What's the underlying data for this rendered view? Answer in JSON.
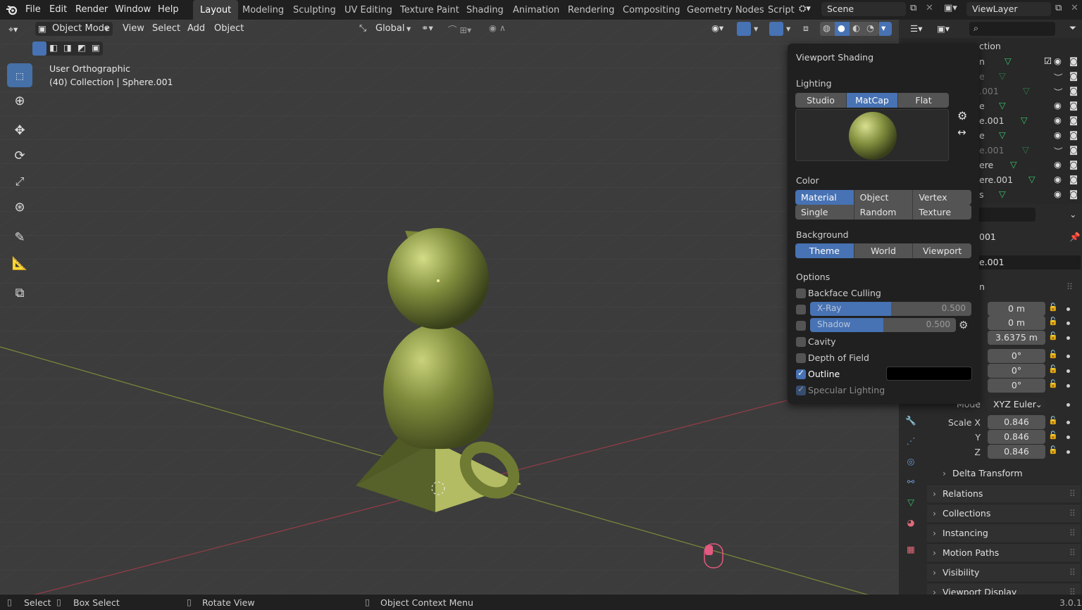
{
  "topbar": {
    "menus": [
      "File",
      "Edit",
      "Render",
      "Window",
      "Help"
    ],
    "workspaces": [
      "Layout",
      "Modeling",
      "Sculpting",
      "UV Editing",
      "Texture Paint",
      "Shading",
      "Animation",
      "Rendering",
      "Compositing",
      "Geometry Nodes",
      "Script"
    ],
    "active_workspace": "Layout",
    "scene": "Scene",
    "view_layer": "ViewLayer"
  },
  "viewport_header": {
    "mode": "Object Mode",
    "menus": [
      "View",
      "Select",
      "Add",
      "Object"
    ],
    "orientation": "Global"
  },
  "viewport": {
    "view_name": "User Orthographic",
    "view_info": "(40) Collection | Sphere.001",
    "matcap_color": "#7a8a3a"
  },
  "shading_popover": {
    "title": "Viewport Shading",
    "lighting_label": "Lighting",
    "lighting_options": [
      "Studio",
      "MatCap",
      "Flat"
    ],
    "lighting_selected": "MatCap",
    "color_label": "Color",
    "color_options": [
      "Material",
      "Object",
      "Vertex",
      "Single",
      "Random",
      "Texture"
    ],
    "color_selected": "Material",
    "background_label": "Background",
    "background_options": [
      "Theme",
      "World",
      "Viewport"
    ],
    "background_selected": "Theme",
    "options_label": "Options",
    "backface_culling": {
      "label": "Backface Culling",
      "checked": false
    },
    "xray": {
      "label": "X-Ray",
      "value": "0.500",
      "fraction": 0.5
    },
    "shadow": {
      "label": "Shadow",
      "value": "0.500",
      "fraction": 0.5
    },
    "cavity": {
      "label": "Cavity",
      "checked": false
    },
    "depth_of_field": {
      "label": "Depth of Field",
      "checked": false
    },
    "outline": {
      "label": "Outline",
      "checked": true,
      "color": "#000000"
    },
    "specular": {
      "label": "Specular Lighting",
      "checked": true
    }
  },
  "outliner": {
    "header_fragment": "ction",
    "rows": [
      "n",
      "e",
      ".001",
      "e",
      "e.001",
      "e",
      "e.001",
      "ere",
      "ere.001",
      "s"
    ]
  },
  "properties": {
    "object_fragment": "001",
    "name_fragment": "e.001",
    "section_fragment": "n",
    "location": [
      "0 m",
      "0 m",
      "3.6375 m"
    ],
    "rotation": [
      "0°",
      "0°",
      "0°"
    ],
    "mode_label": "Mode",
    "rotation_mode": "XYZ Euler",
    "scale_x_label": "Scale X",
    "y_label": "Y",
    "z_label": "Z",
    "scale": [
      "0.846",
      "0.846",
      "0.846"
    ],
    "panels": [
      "Delta Transform",
      "Relations",
      "Collections",
      "Instancing",
      "Motion Paths",
      "Visibility",
      "Viewport Display"
    ]
  },
  "status_bar": {
    "select": "Select",
    "box_select": "Box Select",
    "rotate_view": "Rotate View",
    "context_menu": "Object Context Menu",
    "version": "3.0.1"
  }
}
